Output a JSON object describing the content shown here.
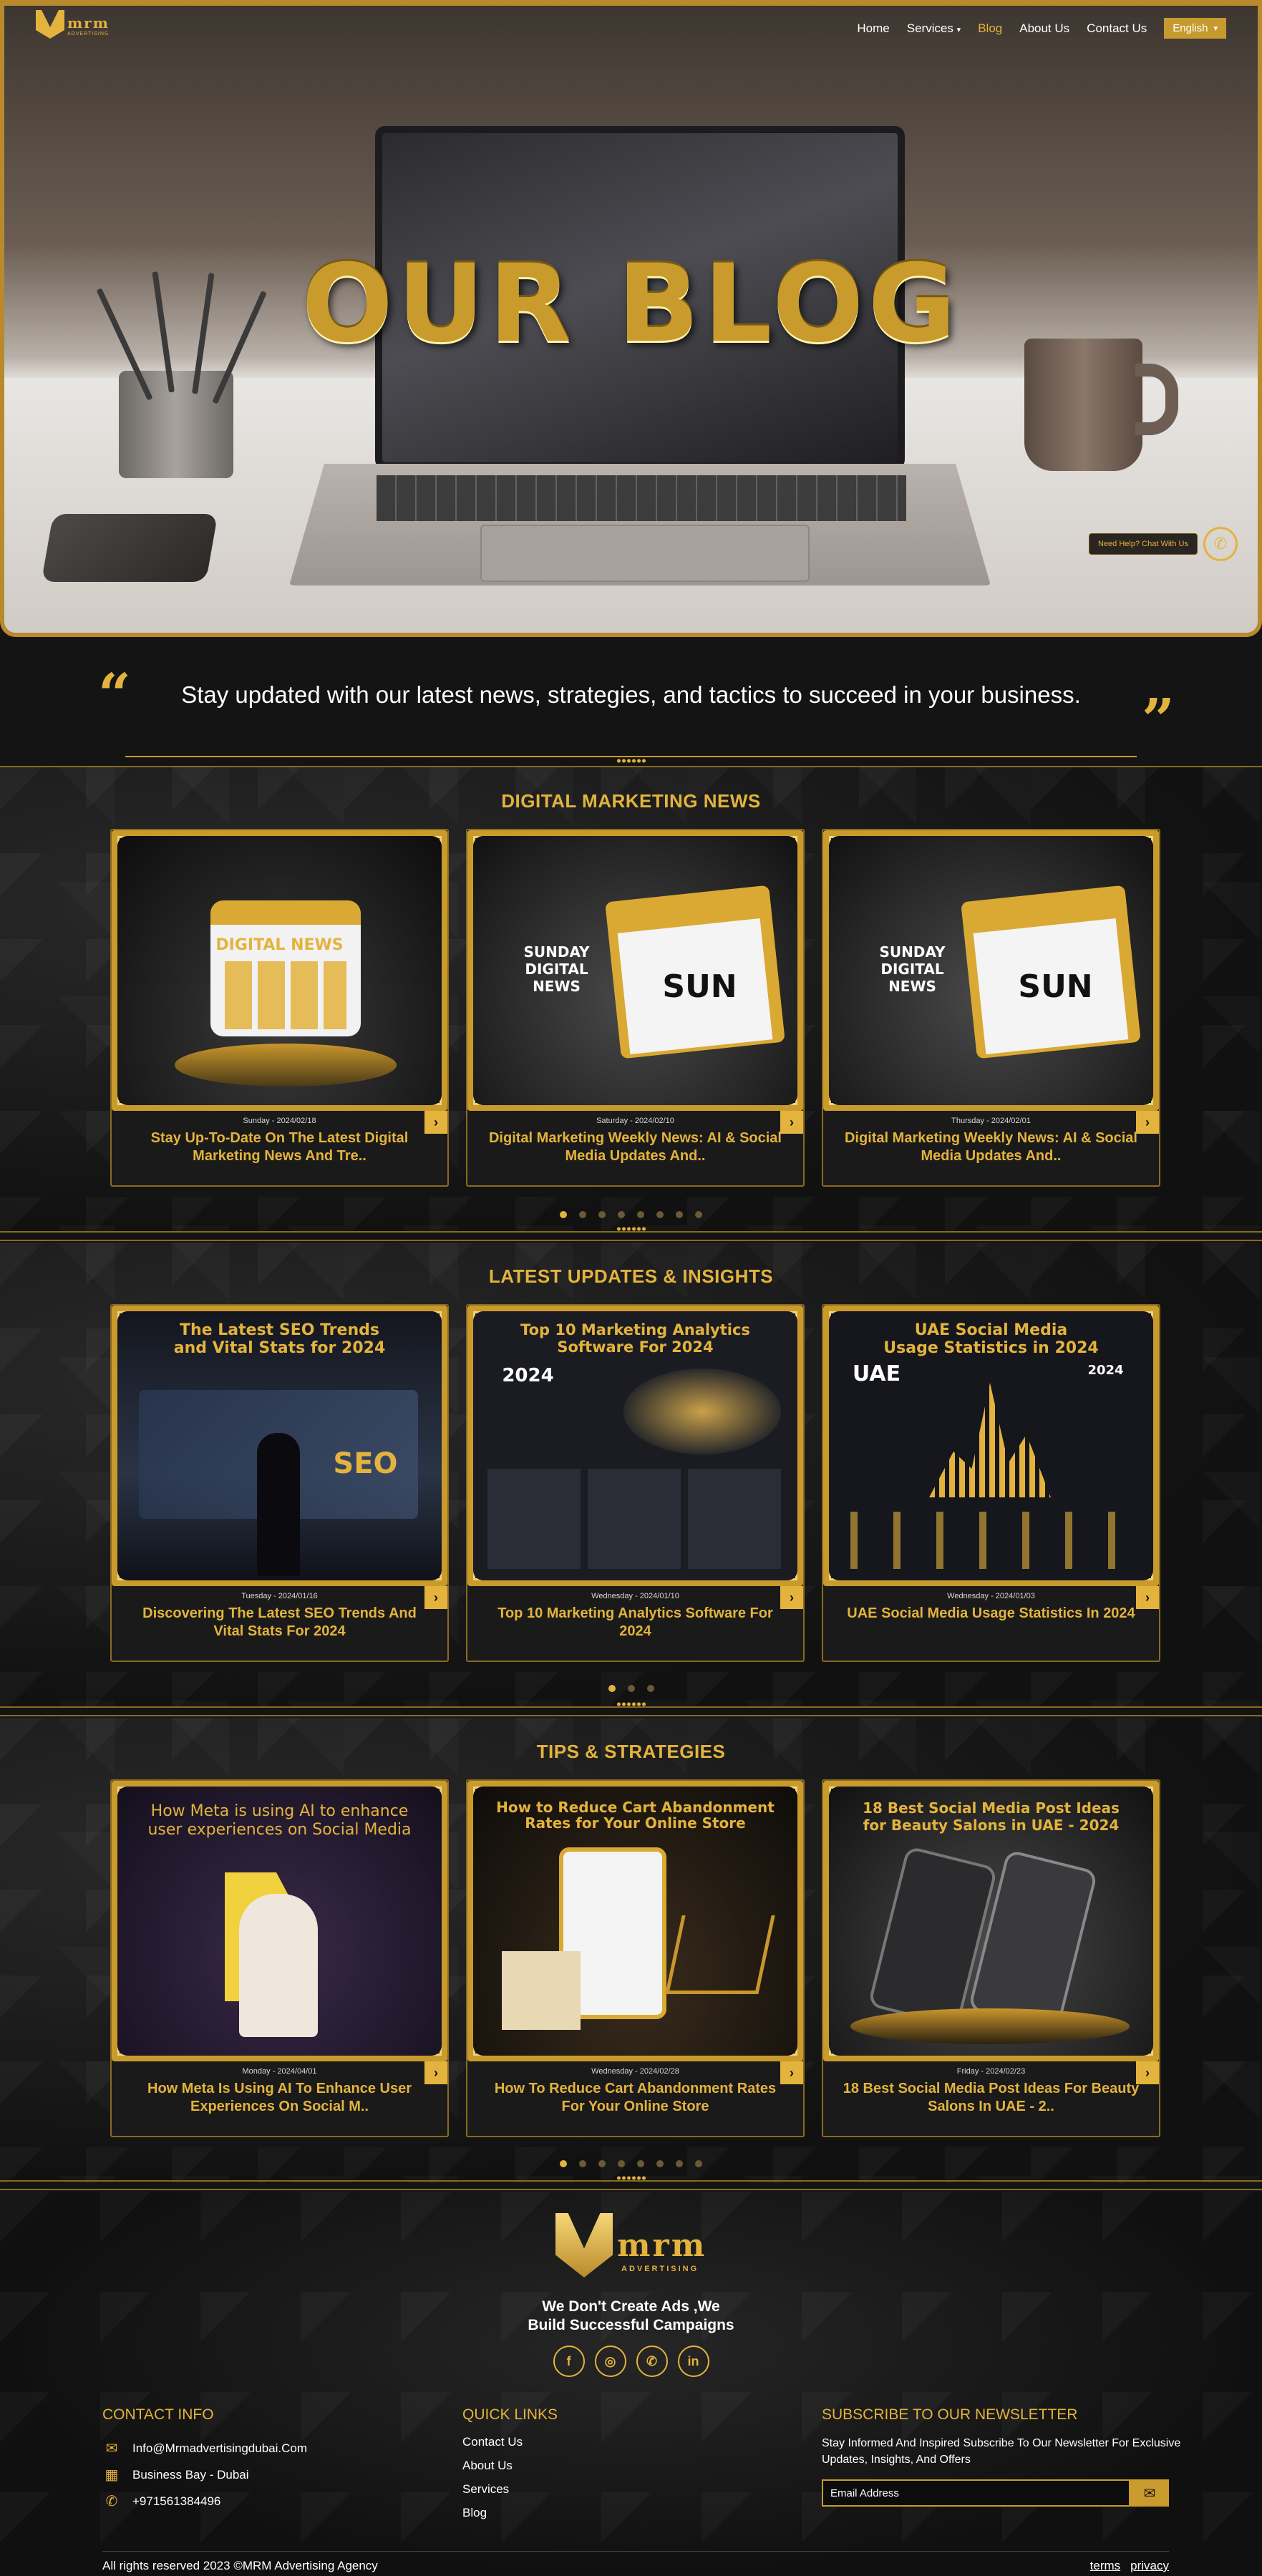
{
  "nav": {
    "logo_text": "mrm",
    "logo_sub": "ADVERTISING",
    "items": [
      {
        "label": "Home"
      },
      {
        "label": "Services"
      },
      {
        "label": "Blog"
      },
      {
        "label": "About Us"
      },
      {
        "label": "Contact Us"
      }
    ],
    "active": "Blog",
    "language": "English"
  },
  "hero": {
    "title": "OUR BLOG",
    "help_label": "Need Help? Chat With Us"
  },
  "intro": {
    "text": "Stay updated with our latest news, strategies, and tactics to succeed in your business."
  },
  "sections": [
    {
      "title": "DIGITAL MARKETING NEWS",
      "cards": [
        {
          "meta": "Sunday - 2024/02/18",
          "title": "Stay Up-To-Date On The Latest Digital Marketing News And Tre..",
          "image_text": [
            "DIGITAL NEWS"
          ]
        },
        {
          "meta": "Saturday - 2024/02/10",
          "title": "Digital Marketing Weekly News: AI & Social Media Updates And..",
          "image_text": [
            "SUNDAY",
            "DIGITAL",
            "NEWS",
            "SUN"
          ]
        },
        {
          "meta": "Thursday - 2024/02/01",
          "title": "Digital Marketing Weekly News: AI & Social Media Updates And..",
          "image_text": [
            "SUNDAY",
            "DIGITAL",
            "NEWS",
            "SUN"
          ]
        }
      ],
      "pages": 8,
      "active_page": 0
    },
    {
      "title": "LATEST UPDATES & INSIGHTS",
      "cards": [
        {
          "meta": "Tuesday - 2024/01/16",
          "title": "Discovering The Latest SEO Trends And Vital Stats For 2024",
          "image_text": [
            "The Latest SEO Trends",
            "and Vital Stats for 2024",
            "SEO"
          ]
        },
        {
          "meta": "Wednesday - 2024/01/10",
          "title": "Top 10 Marketing Analytics Software For 2024",
          "image_text": [
            "Top 10 Marketing Analytics",
            "Software For 2024",
            "2024"
          ]
        },
        {
          "meta": "Wednesday - 2024/01/03",
          "title": "UAE Social Media Usage Statistics In 2024",
          "image_text": [
            "UAE Social Media",
            "Usage Statistics in 2024",
            "UAE",
            "2024"
          ]
        }
      ],
      "pages": 3,
      "active_page": 0
    },
    {
      "title": "TIPS & STRATEGIES",
      "cards": [
        {
          "meta": "Monday - 2024/04/01",
          "title": "How Meta Is Using AI To Enhance User Experiences On Social M..",
          "image_text": [
            "How Meta is using AI to enhance",
            "user experiences on Social Media"
          ]
        },
        {
          "meta": "Wednesday - 2024/02/28",
          "title": "How To Reduce Cart Abandonment Rates For Your Online Store",
          "image_text": [
            "How to Reduce Cart Abandonment",
            "Rates for Your Online Store"
          ]
        },
        {
          "meta": "Friday - 2024/02/23",
          "title": "18 Best Social Media Post Ideas For Beauty Salons In UAE - 2..",
          "image_text": [
            "18 Best Social Media Post Ideas",
            "for Beauty Salons in UAE - 2024"
          ]
        }
      ],
      "pages": 8,
      "active_page": 0
    }
  ],
  "footer": {
    "logo_text": "mrm",
    "logo_sub": "ADVERTISING",
    "tagline_1": "We Don't Create Ads ,We",
    "tagline_2": "Build Successful Campaigns",
    "socials": [
      "f",
      "◎",
      "✆",
      "in"
    ],
    "contact_title": "CONTACT INFO",
    "contact": [
      {
        "icon": "mail-icon",
        "glyph": "✉",
        "text": "Info@Mrmadvertisingdubai.Com"
      },
      {
        "icon": "building-icon",
        "glyph": "▦",
        "text": "Business Bay - Dubai"
      },
      {
        "icon": "phone-icon",
        "glyph": "✆",
        "text": "+971561384496"
      }
    ],
    "links_title": "QUICK LINKS",
    "links": [
      "Contact Us",
      "About Us",
      "Services",
      "Blog"
    ],
    "newsletter_title": "SUBSCRIBE TO OUR NEWSLETTER",
    "newsletter_text": "Stay Informed And Inspired Subscribe To Our Newsletter For Exclusive Updates, Insights, And Offers",
    "email_placeholder": "Email Address",
    "copyright": "All rights reserved 2023 ©MRM Advertising Agency",
    "terms": "terms",
    "privacy": "privacy"
  },
  "colors": {
    "accent": "#e3b33d",
    "background": "#141414",
    "border": "#c99b2c"
  }
}
